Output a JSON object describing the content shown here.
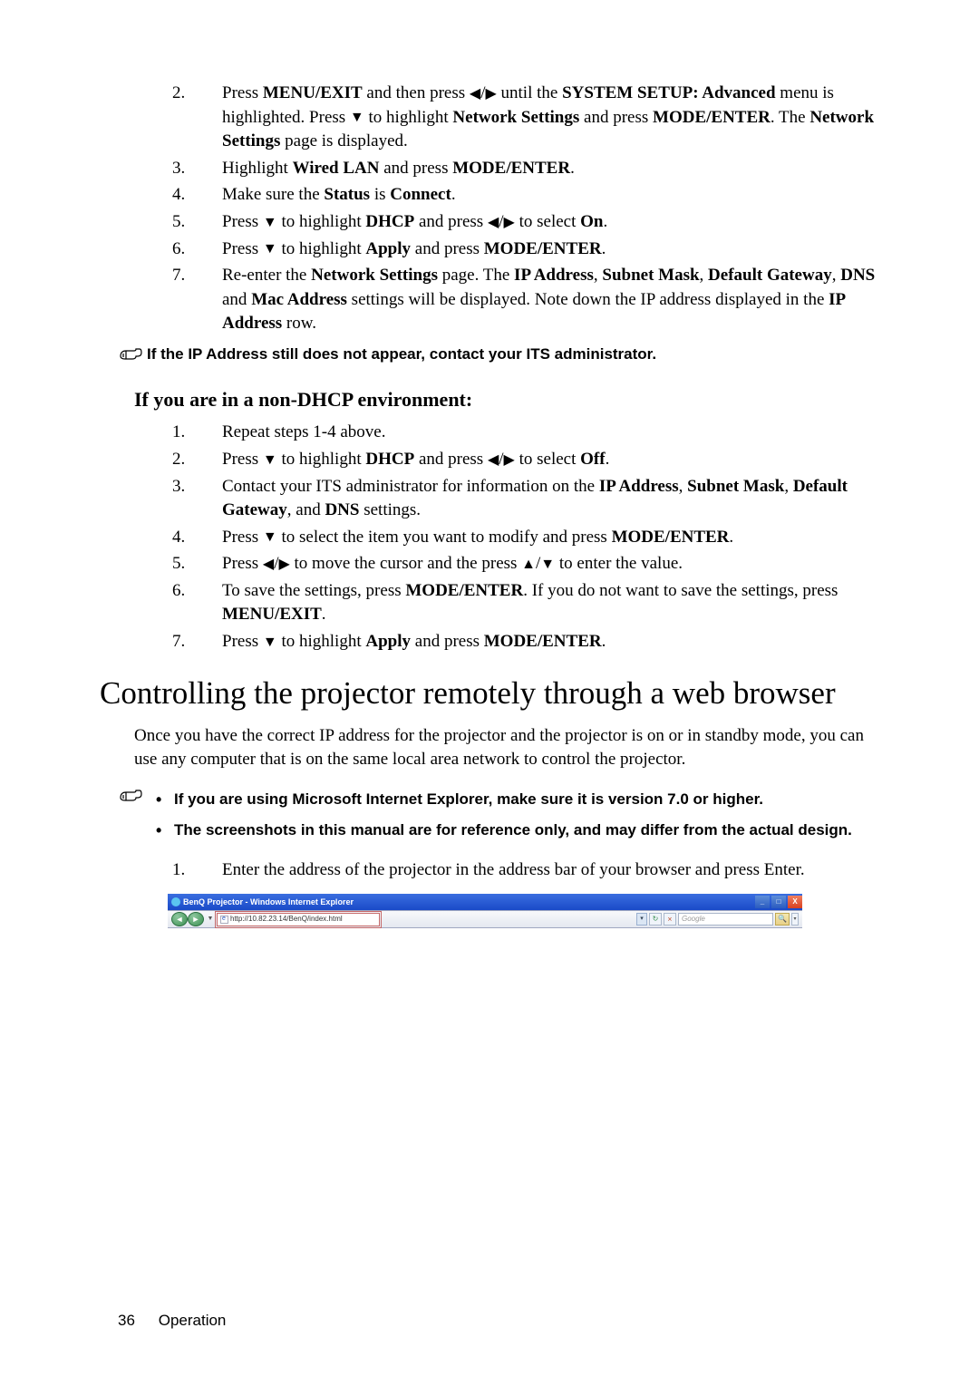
{
  "ol1": {
    "items": [
      {
        "num": "2.",
        "html": "Press <b>MENU/EXIT</b> and then press ◀/▶ until the <b>SYSTEM SETUP: Advanced</b> menu is highlighted. Press ▼ to highlight <b>Network Settings</b> and press <b>MODE/ENTER</b>. The <b>Network Settings</b> page is displayed."
      },
      {
        "num": "3.",
        "html": "Highlight <b>Wired LAN</b> and press <b>MODE/ENTER</b>."
      },
      {
        "num": "4.",
        "html": "Make sure the <b>Status</b> is <b>Connect</b>."
      },
      {
        "num": "5.",
        "html": "Press ▼ to highlight <b>DHCP</b> and press ◀/▶ to select <b>On</b>."
      },
      {
        "num": "6.",
        "html": "Press ▼ to highlight <b>Apply</b> and press <b>MODE/ENTER</b>."
      },
      {
        "num": "7.",
        "html": "Re-enter the <b>Network Settings</b> page. The <b>IP Address</b>, <b>Subnet Mask</b>, <b>Default Gateway</b>, <b>DNS</b> and <b>Mac Address</b> settings will be displayed. Note down the IP address displayed in the <b>IP Address</b> row."
      }
    ]
  },
  "note1": "If the IP Address still does not appear, contact your ITS administrator.",
  "subheading1": "If you are in a non-DHCP environment:",
  "ol2": {
    "items": [
      {
        "num": "1.",
        "html": "Repeat steps 1-4 above."
      },
      {
        "num": "2.",
        "html": "Press ▼ to highlight <b>DHCP</b> and press ◀/▶ to select <b>Off</b>."
      },
      {
        "num": "3.",
        "html": "Contact your ITS administrator for information on the <b>IP Address</b>, <b>Subnet Mask</b>, <b>Default Gateway</b>, and <b>DNS</b> settings."
      },
      {
        "num": "4.",
        "html": "Press ▼ to select the item you want to modify and press <b>MODE/ENTER</b>."
      },
      {
        "num": "5.",
        "html": "Press ◀/▶ to move the cursor and the press ▲/▼ to enter the value."
      },
      {
        "num": "6.",
        "html": "To save the settings, press <b>MODE/ENTER</b>. If you do not want to save the settings, press <b>MENU/EXIT</b>."
      },
      {
        "num": "7.",
        "html": "Press ▼ to highlight <b>Apply</b> and press <b>MODE/ENTER</b>."
      }
    ]
  },
  "h1": "Controlling the projector remotely through a web browser",
  "para1": "Once you have the correct IP address for the projector and the projector is on or in standby mode, you can use any computer that is on the same local area network to control the projector.",
  "note2": {
    "items": [
      "If you are using Microsoft Internet Explorer, make sure it is version 7.0 or higher.",
      "The screenshots in this manual are for reference only, and may differ from the actual design."
    ]
  },
  "ol3": {
    "items": [
      {
        "num": "1.",
        "html": "Enter the address of the projector in the address bar of your browser and press Enter."
      }
    ]
  },
  "screenshot": {
    "title": "BenQ Projector - Windows Internet Explorer",
    "url": "http://10.82.23.14/BenQ/index.html",
    "search_placeholder": "Google"
  },
  "footer": {
    "page": "36",
    "section": "Operation"
  }
}
